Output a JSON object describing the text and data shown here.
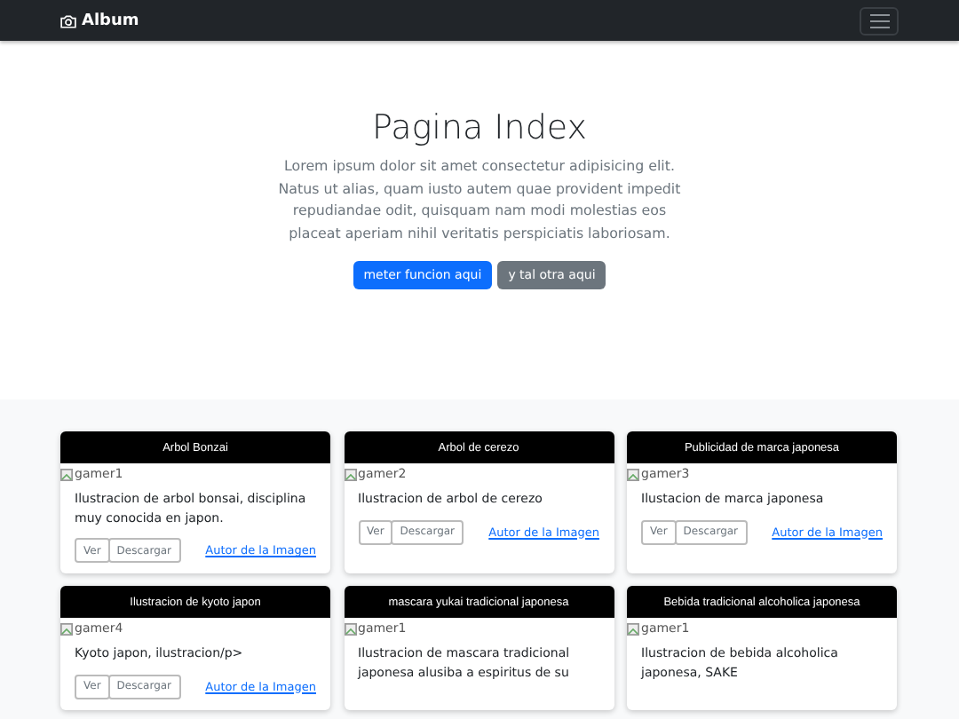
{
  "navbar": {
    "brand": "Album"
  },
  "hero": {
    "title": "Pagina Index",
    "text": "Lorem ipsum dolor sit amet consectetur adipisicing elit. Natus ut alias, quam iusto autem quae provident impedit repudiandae odit, quisquam nam modi molestias eos placeat aperiam nihil veritatis perspiciatis laboriosam.",
    "buttons": [
      {
        "label": "meter funcion aqui",
        "kind": "primary"
      },
      {
        "label": "y tal otra aqui",
        "kind": "secondary"
      }
    ]
  },
  "cards": [
    {
      "title": "Arbol Bonzai",
      "image_alt": "gamer1",
      "text": "Ilustracion de arbol bonsai, disciplina muy conocida en japon.",
      "buttons": [
        "Ver",
        "Descargar"
      ],
      "link": "Autor de la Imagen"
    },
    {
      "title": "Arbol de cerezo",
      "image_alt": "gamer2",
      "text": "Ilustracion de arbol de cerezo",
      "buttons": [
        "Ver",
        "Descargar"
      ],
      "link": "Autor de la Imagen"
    },
    {
      "title": "Publicidad de marca japonesa",
      "image_alt": "gamer3",
      "text": "Ilustacion de marca japonesa",
      "buttons": [
        "Ver",
        "Descargar"
      ],
      "link": "Autor de la Imagen"
    },
    {
      "title": "Ilustracion de kyoto japon",
      "image_alt": "gamer4",
      "text": "Kyoto japon, ilustracion/p>",
      "buttons": [
        "Ver",
        "Descargar"
      ],
      "link": "Autor de la Imagen"
    },
    {
      "title": "mascara yukai tradicional japonesa",
      "image_alt": "gamer1",
      "text": "Ilustracion de mascara tradicional japonesa alusiba a espiritus de su"
    },
    {
      "title": "Bebida tradicional alcoholica japonesa",
      "image_alt": "gamer1",
      "text": "Ilustracion de bebida alcoholica japonesa, SAKE"
    }
  ]
}
